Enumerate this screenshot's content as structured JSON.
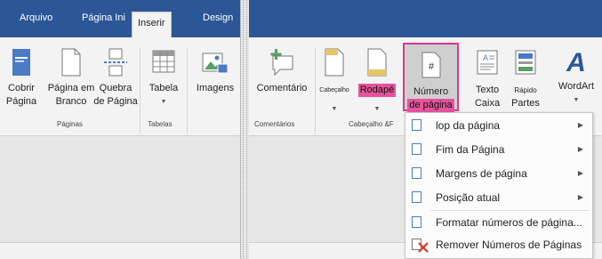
{
  "left_ribbon": {
    "tabs": [
      "Arquivo",
      "Página Ini",
      "Inserir",
      "Design"
    ],
    "buttons": {
      "cobrir": [
        "Cobrir",
        "Página"
      ],
      "pagina_em_branco": [
        "Página em",
        "Branco"
      ],
      "quebra": [
        "Quebra",
        "de Página"
      ],
      "tabela": "Tabela",
      "imagens": "Imagens"
    },
    "groups": [
      "Páginas",
      "Tabelas"
    ]
  },
  "right_ribbon": {
    "buttons": {
      "comentario": "Comentário",
      "cabecalho": "Cabeçalho",
      "rodape": "Rodapé",
      "numero": [
        "Número",
        "de página"
      ],
      "texto": [
        "Texto",
        "Caixa"
      ],
      "rapido": [
        "Rápido",
        "Partes"
      ],
      "wordart": "WordArt"
    },
    "groups": [
      "Comentários",
      "Cabeçalho &F"
    ]
  },
  "menu": {
    "items": [
      {
        "label": "lop da página",
        "icon": "page-top-number-icon",
        "submenu": true
      },
      {
        "label": "Fim da Página",
        "icon": "page-bottom-number-icon",
        "submenu": true
      },
      {
        "label": "Margens de página",
        "icon": "page-margin-number-icon",
        "submenu": true
      },
      {
        "label": "Posição atual",
        "icon": "page-current-number-icon",
        "submenu": true
      },
      {
        "label": "Formatar números de página...",
        "icon": "format-page-numbers-icon",
        "submenu": false
      },
      {
        "label": "Remover Números de Páginas",
        "icon": "remove-page-numbers-icon",
        "submenu": false
      }
    ]
  },
  "colors": {
    "ribbon_blue": "#2b5797",
    "highlight_rose": "#e6539c",
    "highlight_border": "#d83a93",
    "remove_x_red": "#e0301e",
    "icon_blue": "#4b7ac6",
    "icon_green": "#5a9e63"
  }
}
